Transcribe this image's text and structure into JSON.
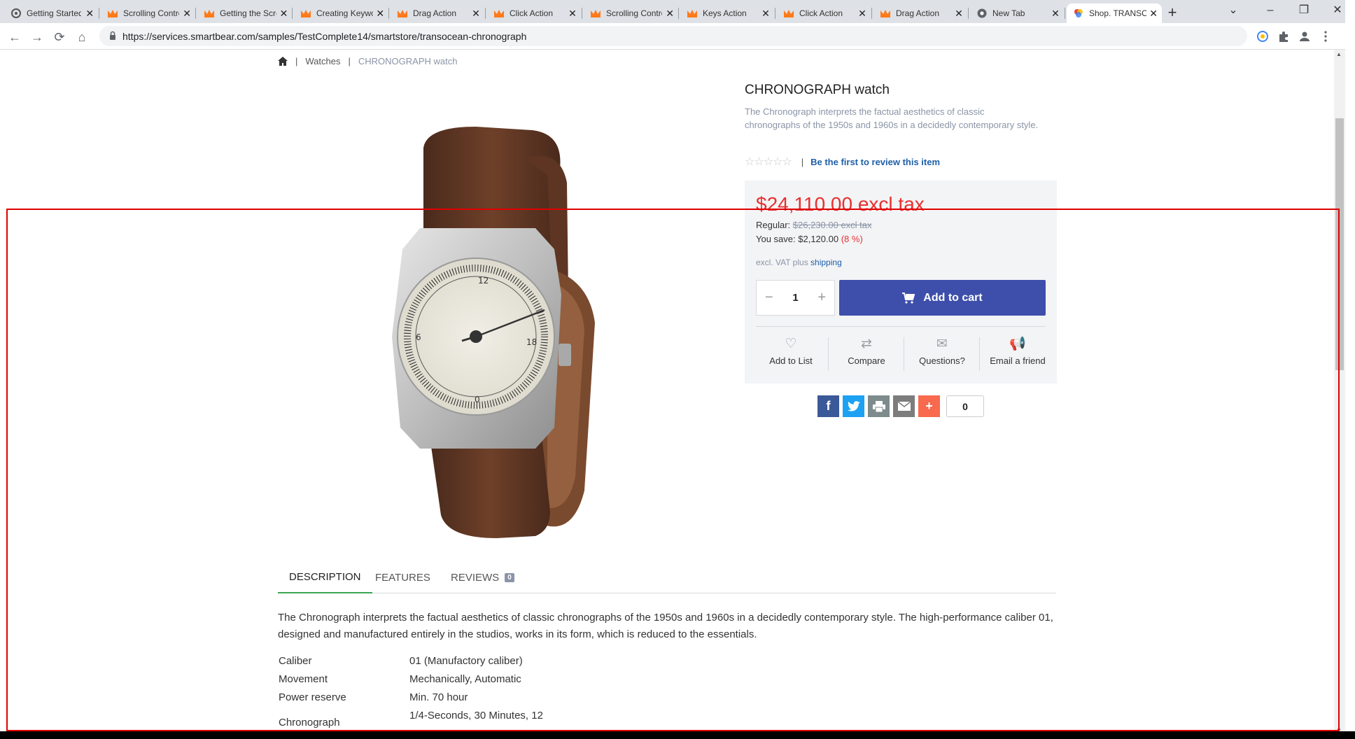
{
  "browser": {
    "tabs": [
      {
        "title": "Getting Started",
        "icon": "smartbear-icon"
      },
      {
        "title": "Scrolling Controls",
        "icon": "testcomplete-icon"
      },
      {
        "title": "Getting the Screen",
        "icon": "testcomplete-icon"
      },
      {
        "title": "Creating Keyword",
        "icon": "testcomplete-icon"
      },
      {
        "title": "Drag Action",
        "icon": "testcomplete-icon"
      },
      {
        "title": "Click Action",
        "icon": "testcomplete-icon"
      },
      {
        "title": "Scrolling Controls",
        "icon": "testcomplete-icon"
      },
      {
        "title": "Keys Action",
        "icon": "testcomplete-icon"
      },
      {
        "title": "Click Action",
        "icon": "testcomplete-icon"
      },
      {
        "title": "Drag Action",
        "icon": "testcomplete-icon"
      },
      {
        "title": "New Tab",
        "icon": "chrome-icon"
      },
      {
        "title": "Shop. TRANSOCEAN",
        "icon": "smartstore-icon",
        "active": true
      }
    ],
    "tab_close_glyph": "✕",
    "new_tab_glyph": "+",
    "url": "https://services.smartbear.com/samples/TestComplete14/smartstore/transocean-chronograph"
  },
  "breadcrumb": {
    "home_icon": "home-icon",
    "separator": "|",
    "category": "Watches",
    "current": "CHRONOGRAPH watch"
  },
  "product": {
    "title": "CHRONOGRAPH watch",
    "short_description": "The Chronograph interprets the factual aesthetics of classic chronographs of the 1950s and 1960s in a decidedly contemporary style.",
    "stars": "☆☆☆☆☆",
    "rating_separator": "|",
    "review_link": "Be the first to review this item",
    "price": "$24,110.00 excl tax",
    "regular_label": "Regular:",
    "regular_price": "$26,230.00 excl tax",
    "you_save_label": "You save:",
    "you_save_amount": "$2,120.00",
    "you_save_percent": "(8 %)",
    "vat_text": "excl. VAT plus",
    "shipping_link": "shipping",
    "quantity": "1",
    "qty_minus": "−",
    "qty_plus": "+",
    "add_to_cart": "Add to cart",
    "actions": [
      {
        "label": "Add to List",
        "icon": "heart-icon"
      },
      {
        "label": "Compare",
        "icon": "compare-icon"
      },
      {
        "label": "Questions?",
        "icon": "envelope-icon"
      },
      {
        "label": "Email a friend",
        "icon": "megaphone-icon"
      }
    ],
    "share_count": "0"
  },
  "tabs": [
    {
      "label": "DESCRIPTION",
      "active": true
    },
    {
      "label": "FEATURES"
    },
    {
      "label": "REVIEWS",
      "badge": "0"
    }
  ],
  "description": "The Chronograph interprets the factual aesthetics of classic chronographs of the 1950s and 1960s in a decidedly contemporary style. The high-performance caliber 01, designed and manufactured entirely in the studios, works in its form, which is reduced to the essentials.",
  "specs": [
    {
      "key": "Caliber",
      "value": "01 (Manufactory caliber)"
    },
    {
      "key": "Movement",
      "value": "Mechanically, Automatic"
    },
    {
      "key": "Power reserve",
      "value": "Min. 70 hour"
    },
    {
      "key": "Chronograph",
      "value": "1/4-Seconds, 30 Minutes, 12"
    }
  ],
  "colors": {
    "price": "#e8302f",
    "cart_button": "#3d4fab",
    "link": "#1e5fa8",
    "muted": "#8a94a6",
    "active_tab_underline": "#3aa652",
    "highlight_box": "#e00000",
    "facebook": "#3b5998",
    "twitter": "#1da1f2",
    "print": "#7d8b8c",
    "email": "#7d7d7d",
    "addthis": "#f8694d"
  }
}
